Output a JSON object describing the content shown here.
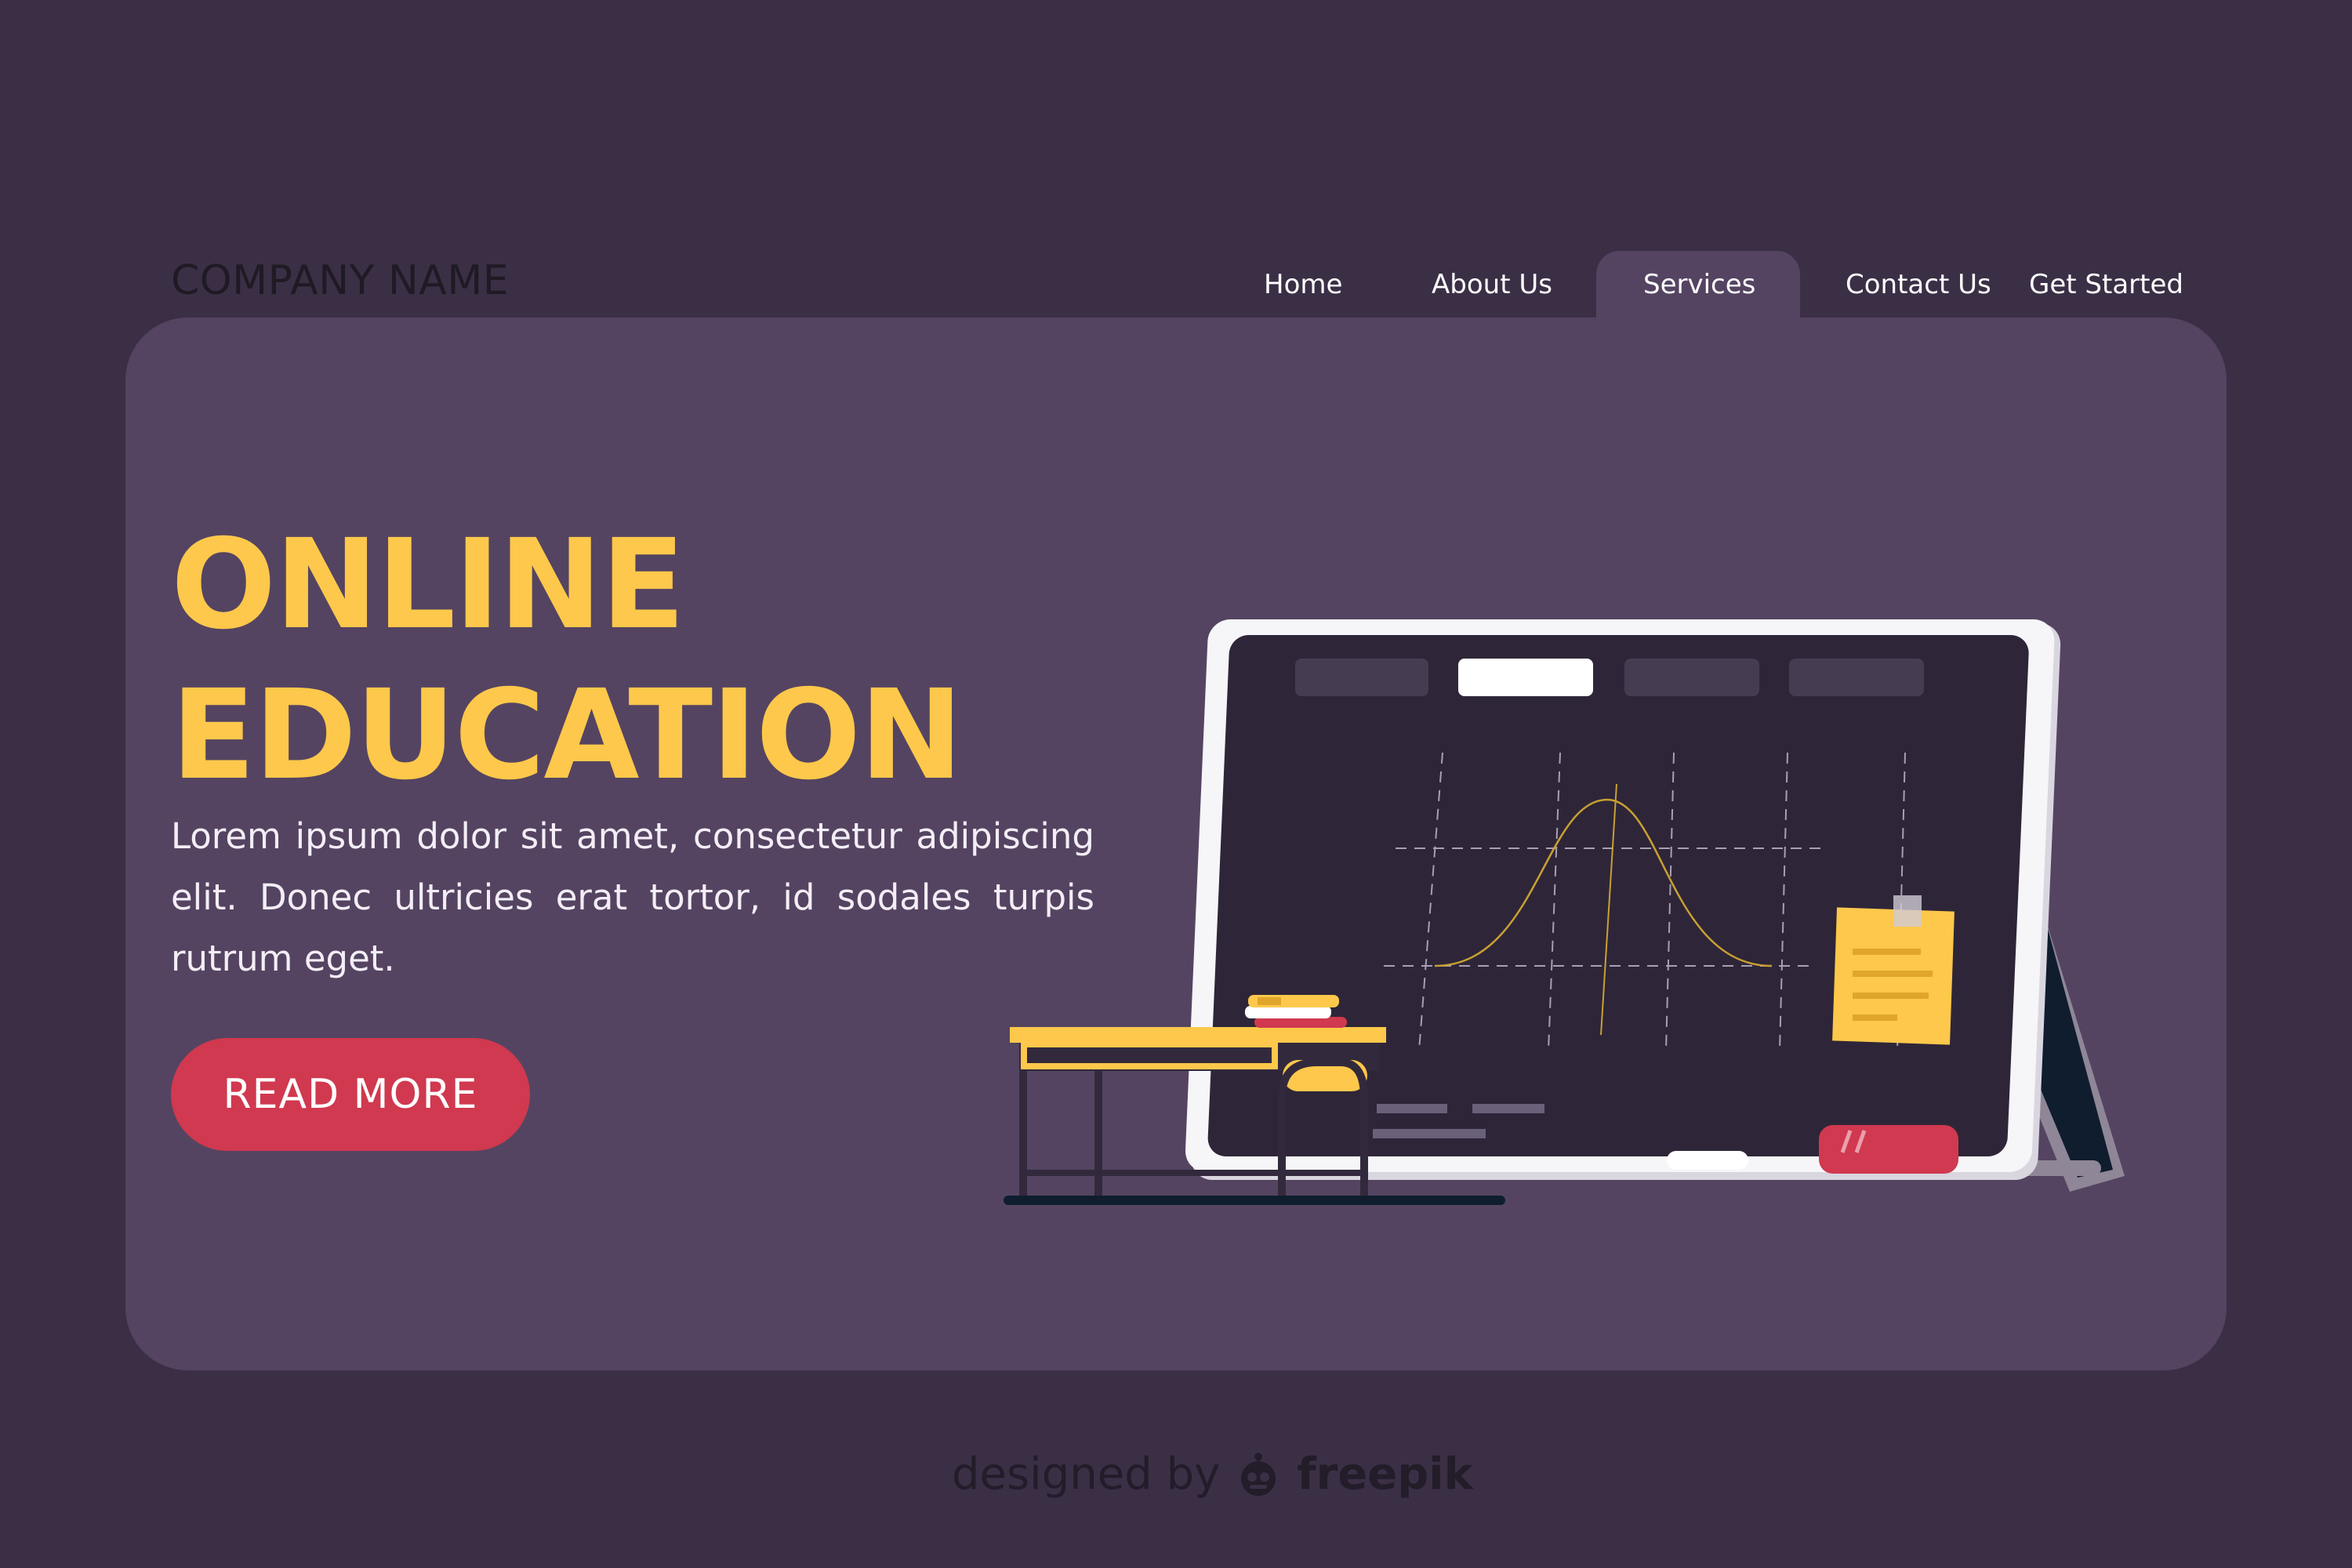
{
  "header": {
    "company_name": "COMPANY NAME",
    "nav": [
      {
        "label": "Home"
      },
      {
        "label": "About Us"
      },
      {
        "label": "Services",
        "active": true
      },
      {
        "label": "Contact Us"
      },
      {
        "label": "Get Started"
      }
    ]
  },
  "hero": {
    "title_line1": "ONLINE",
    "title_line2": "EDUCATION",
    "body": "Lorem ipsum dolor sit amet, consectetur adipiscing elit. Donec ultricies erat tortor, id sodales turpis rutrum eget.",
    "cta_label": "READ MORE"
  },
  "footer": {
    "credit_prefix": "designed by",
    "credit_brand": "freepik",
    "credit_icon": "freepik-logo-icon"
  },
  "colors": {
    "background": "#3b2f46",
    "panel": "#544461",
    "accent_yellow": "#fdc84b",
    "cta_red": "#d0394f"
  }
}
